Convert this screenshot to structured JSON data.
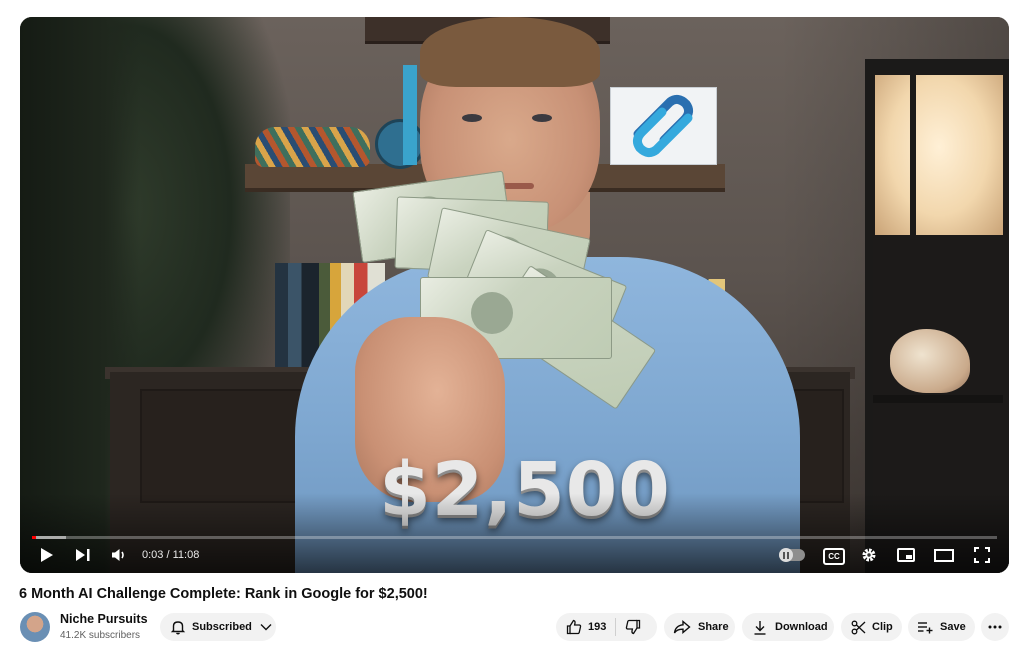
{
  "video": {
    "overlay_text": "$2,500",
    "progress_fraction": 0.0045,
    "loaded_fraction": 0.035,
    "time_current": "0:03",
    "time_separator": "/",
    "time_total": "11:08"
  },
  "title": "6 Month AI Challenge Complete: Rank in Google for $2,500!",
  "channel": {
    "name": "Niche Pursuits",
    "subscribers": "41.2K subscribers",
    "subscribe_label": "Subscribed"
  },
  "actions": {
    "like_count": "193",
    "share": "Share",
    "download": "Download",
    "clip": "Clip",
    "save": "Save"
  },
  "icons": {
    "play": "play-icon",
    "next": "next-icon",
    "volume": "volume-icon",
    "autoplay": "autoplay-toggle",
    "captions": "cc-icon",
    "settings": "gear-icon",
    "miniplayer": "miniplayer-icon",
    "theater": "theater-icon",
    "fullscreen": "fullscreen-icon"
  },
  "colors": {
    "progress": "#ff0000",
    "pill_bg": "#f2f2f2"
  }
}
